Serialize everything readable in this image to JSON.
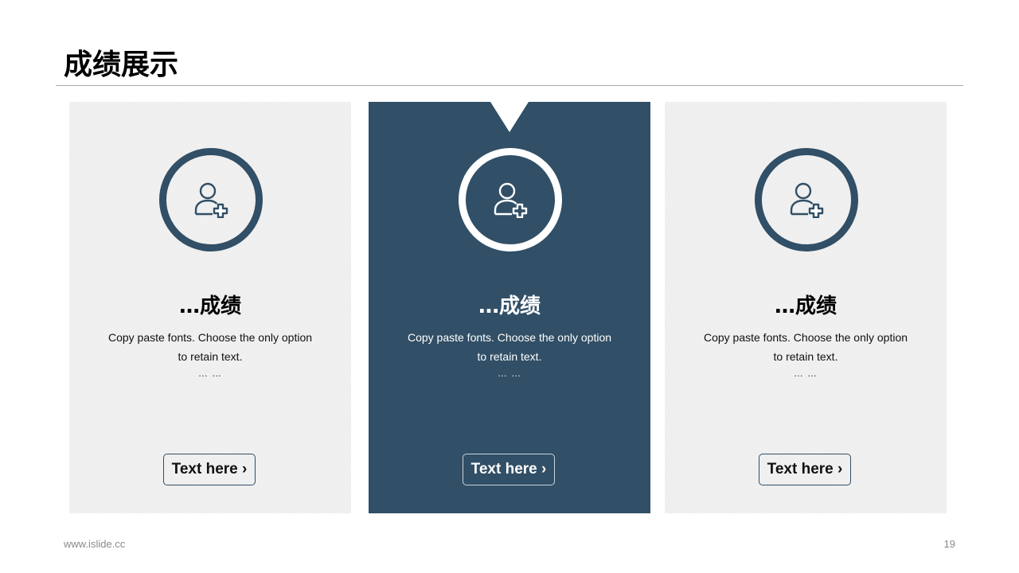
{
  "header": {
    "title": "成绩展示"
  },
  "cards": [
    {
      "title": "…成绩",
      "desc_line1": "Copy paste fonts. Choose the only option",
      "desc_line2": "to retain text.",
      "ellipsis": "… …",
      "button_label": "Text here ›",
      "icon": "user-add-icon"
    },
    {
      "title": "…成绩",
      "desc_line1": "Copy paste fonts. Choose the only option",
      "desc_line2": "to retain text.",
      "ellipsis": "… …",
      "button_label": "Text here ›",
      "icon": "user-add-icon",
      "highlighted": true
    },
    {
      "title": "…成绩",
      "desc_line1": "Copy paste fonts. Choose the only option",
      "desc_line2": "to retain text.",
      "ellipsis": "… …",
      "button_label": "Text here ›",
      "icon": "user-add-icon"
    }
  ],
  "footer": {
    "url": "www.islide.cc",
    "page_number": "19"
  },
  "colors": {
    "accent": "#314f66",
    "card_bg": "#f1f1f1",
    "rule": "#a8a8a8"
  }
}
